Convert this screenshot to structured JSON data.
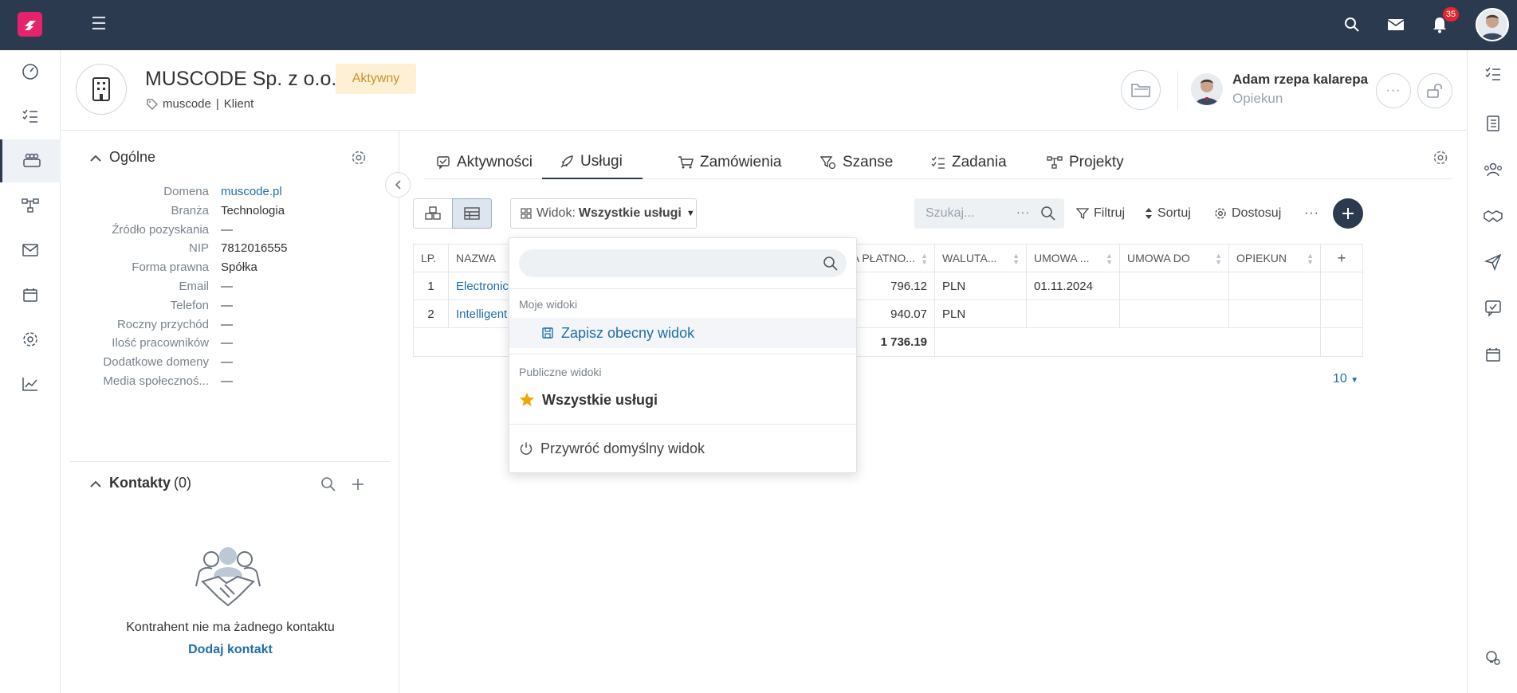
{
  "topbar": {
    "notification_count": "35"
  },
  "header": {
    "company_name": "MUSCODE Sp. z o.o.",
    "status": "Aktywny",
    "tag": "muscode",
    "tag_sep": "|",
    "type": "Klient",
    "owner_name": "Adam rzepa kalarepa",
    "owner_role": "Opiekun"
  },
  "general": {
    "title": "Ogólne",
    "fields": [
      {
        "label": "Domena",
        "value": "muscode.pl"
      },
      {
        "label": "Branża",
        "value": "Technologia"
      },
      {
        "label": "Źródło pozyskania",
        "value": "—"
      },
      {
        "label": "NIP",
        "value": "7812016555"
      },
      {
        "label": "Forma prawna",
        "value": "Spółka"
      },
      {
        "label": "Email",
        "value": "—"
      },
      {
        "label": "Telefon",
        "value": "—"
      },
      {
        "label": "Roczny przychód",
        "value": "—"
      },
      {
        "label": "Ilość pracowników",
        "value": "—"
      },
      {
        "label": "Dodatkowe domeny",
        "value": "—"
      },
      {
        "label": "Media społecznoś...",
        "value": "—"
      }
    ]
  },
  "contacts": {
    "title": "Kontakty",
    "count": "(0)",
    "empty_text": "Kontrahent nie ma żadnego kontaktu",
    "add_link": "Dodaj kontakt"
  },
  "tabs": [
    "Aktywności",
    "Usługi",
    "Zamówienia",
    "Szanse",
    "Zadania",
    "Projekty"
  ],
  "toolbar": {
    "view_prefix": "Widok:",
    "view_name": "Wszystkie usługi",
    "search_placeholder": "Szukaj...",
    "filter": "Filtruj",
    "sort": "Sortuj",
    "customize": "Dostosuj",
    "more": "···"
  },
  "table": {
    "headers": [
      "LP.",
      "NAZWA",
      "",
      "KWOTA PŁATNO...",
      "WALUTA...",
      "UMOWA ...",
      "UMOWA DO",
      "OPIEKUN",
      "+"
    ],
    "rows": [
      [
        "1",
        "Electronic",
        "",
        "796.12",
        "PLN",
        "01.11.2024",
        "",
        "",
        ""
      ],
      [
        "2",
        "Intelligent",
        "",
        "940.07",
        "PLN",
        "",
        "",
        "",
        ""
      ]
    ],
    "total": "1 736.19",
    "page_size": "10"
  },
  "dropdown": {
    "my_views": "Moje widoki",
    "save_view": "Zapisz obecny widok",
    "public_views": "Publiczne widoki",
    "all_services": "Wszystkie usługi",
    "restore": "Przywróć domyślny widok"
  },
  "colors": {
    "topbar": "#2b3a4e",
    "brand": "#e6236a",
    "link": "#1f6fa8",
    "status_bg": "#fdf0d5",
    "status_fg": "#c8932a",
    "star": "#f0a500"
  }
}
